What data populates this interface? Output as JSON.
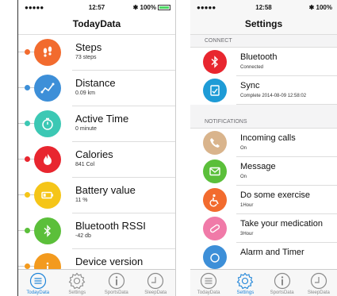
{
  "left": {
    "status": {
      "signal": "●●●●● ",
      "time": "12:57",
      "battery": "✱ 100%"
    },
    "title": "TodayData",
    "items": [
      {
        "title": "Steps",
        "sub": "73 steps",
        "color": "#f26b2e",
        "dot": "#f26b2e",
        "icon": "footprints-icon"
      },
      {
        "title": "Distance",
        "sub": "0.09 km",
        "color": "#3d8fd8",
        "dot": "#3d8fd8",
        "icon": "route-icon"
      },
      {
        "title": "Active Time",
        "sub": "0 minute",
        "color": "#3cc8b4",
        "dot": "#3cc8b4",
        "icon": "stopwatch-icon"
      },
      {
        "title": "Calories",
        "sub": "841 Col",
        "color": "#e8262f",
        "dot": "#e8262f",
        "icon": "flame-icon"
      },
      {
        "title": "Battery value",
        "sub": "11 %",
        "color": "#f5c518",
        "dot": "#f5c518",
        "icon": "battery-icon"
      },
      {
        "title": "Bluetooth RSSI",
        "sub": "-42 db",
        "color": "#5bbf3a",
        "dot": "#5bbf3a",
        "icon": "bluetooth-icon"
      },
      {
        "title": "Device version",
        "sub": "",
        "color": "#f39a1e",
        "dot": "#f39a1e",
        "icon": "info-icon"
      }
    ],
    "tabs": [
      {
        "label": "TodayData",
        "active": true
      },
      {
        "label": "Settings",
        "active": false
      },
      {
        "label": "SportsData",
        "active": false
      },
      {
        "label": "SleepData",
        "active": false
      }
    ]
  },
  "right": {
    "status": {
      "signal": "●●●●● ",
      "time": "12:58",
      "battery": "✱ 100%"
    },
    "title": "Settings",
    "sections": [
      {
        "header": "CONNECT",
        "items": [
          {
            "title": "Bluetooth",
            "sub": "Connected",
            "color": "#e8262f",
            "icon": "bluetooth-icon"
          },
          {
            "title": "Sync",
            "sub": "Complete  2014-08-09 12:58:02",
            "color": "#1e9bd6",
            "icon": "sync-icon"
          }
        ]
      },
      {
        "header": "NOTIFICATIONS",
        "items": [
          {
            "title": "Incoming calls",
            "sub": "On",
            "color": "#d9b48c",
            "icon": "phone-icon"
          },
          {
            "title": "Message",
            "sub": "On",
            "color": "#5bbf3a",
            "icon": "message-icon"
          },
          {
            "title": "Do some exercise",
            "sub": "1Hour",
            "color": "#f26b2e",
            "icon": "exercise-icon"
          },
          {
            "title": "Take your medication",
            "sub": "3Hour",
            "color": "#f07aa8",
            "icon": "pill-icon"
          },
          {
            "title": "Alarm and Timer",
            "sub": "",
            "color": "#3d8fd8",
            "icon": "alarm-icon"
          }
        ]
      }
    ],
    "tabs": [
      {
        "label": "TodayData",
        "active": false
      },
      {
        "label": "Settings",
        "active": true
      },
      {
        "label": "SportsData",
        "active": false
      },
      {
        "label": "SleepData",
        "active": false
      }
    ]
  }
}
